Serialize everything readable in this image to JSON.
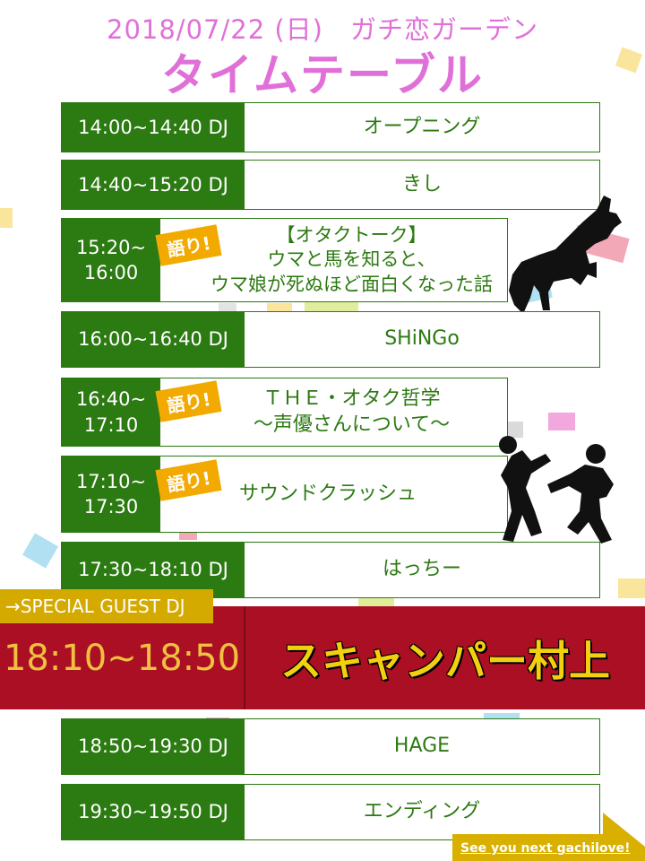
{
  "header": {
    "date": "2018/07/22 (日)　ガチ恋ガーデン",
    "title": "タイムテーブル"
  },
  "tag_label": "語り!",
  "schedule": [
    {
      "time": "14:00~14:40 DJ",
      "act": "オープニング"
    },
    {
      "time": "14:40~15:20 DJ",
      "act": "きし"
    },
    {
      "time_line1": "15:20~",
      "time_line2": "16:00",
      "act_line1": "【オタクトーク】",
      "act_line2": "ウマと馬を知ると、",
      "act_line3": "ウマ娘が死ぬほど面白くなった話"
    },
    {
      "time": "16:00~16:40 DJ",
      "act": "SHiNGo"
    },
    {
      "time_line1": "16:40~",
      "time_line2": "17:10",
      "act_line1": "ＴＨＥ・オタク哲学",
      "act_line2": "～声優さんについて～"
    },
    {
      "time_line1": "17:10~",
      "time_line2": "17:30",
      "act": "サウンドクラッシュ"
    },
    {
      "time": "17:30~18:10 DJ",
      "act": "はっちー"
    },
    {
      "time": "18:50~19:30 DJ",
      "act": "HAGE"
    },
    {
      "time": "19:30~19:50 DJ",
      "act": "エンディング"
    }
  ],
  "special": {
    "banner": "→SPECIAL GUEST DJ",
    "time": "18:10~18:50",
    "act": "スキャンパー村上"
  },
  "footer": {
    "text": "See you next gachilove!"
  },
  "colors": {
    "accent_pink": "#e070d8",
    "row_green": "#2c7a12",
    "special_red": "#ab0f23",
    "tag_orange": "#f2a900"
  }
}
